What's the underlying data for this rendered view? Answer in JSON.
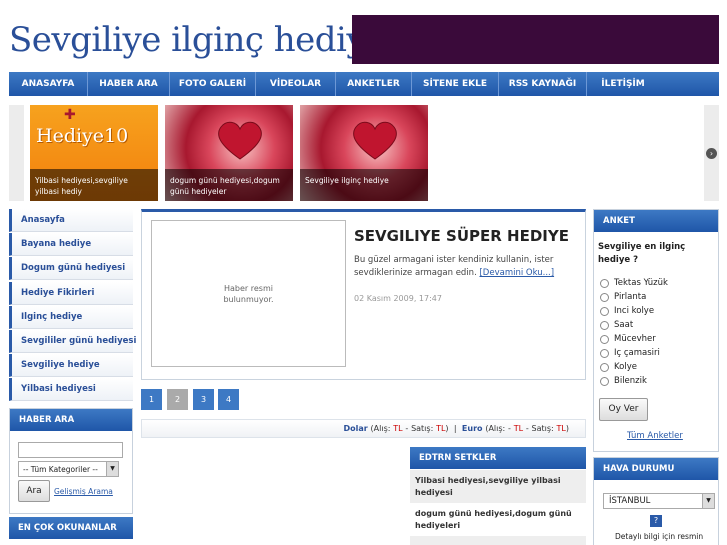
{
  "header": {
    "site_title": "Sevgiliye ilginç hediye",
    "banner_color": "#3a0a3a"
  },
  "nav": {
    "items": [
      "ANASAYFA",
      "HABER ARA",
      "FOTO GALERİ",
      "VİDEOLAR",
      "ANKETLER",
      "SİTENE EKLE",
      "RSS KAYNAĞI",
      "İLETİŞİM"
    ]
  },
  "slider": {
    "logo_text": "Hediye10",
    "slides": [
      {
        "caption": "Yilbasi hediyesi,sevgiliye yilbasi hediy"
      },
      {
        "caption": "dogum günü hediyesi,dogum günü hediyeler"
      },
      {
        "caption": "Sevgiliye ilginç hediye"
      }
    ]
  },
  "sidebar": {
    "items": [
      "Anasayfa",
      "Bayana hediye",
      "Dogum günü hediyesi",
      "Hediye Fikirleri",
      "Ilginç hediye",
      "Sevgililer günü hediyesi",
      "Sevgiliye hediye",
      "Yilbasi hediyesi"
    ]
  },
  "search": {
    "header": "HABER ARA",
    "category": "-- Tüm Kategoriler --",
    "button": "Ara",
    "advanced": "Gelişmiş Arama"
  },
  "most_read": {
    "header": "EN ÇOK OKUNANLAR"
  },
  "article": {
    "no_image_line1": "Haber resmi",
    "no_image_line2": "bulunmuyor.",
    "title": "SEVGILIYE SÜPER HEDIYE",
    "body": "Bu güzel armagani ister kendiniz kullanin, ister sevdiklerinize armagan edin.",
    "more": "[Devamini Oku...]",
    "date": "02 Kasım 2009, 17:47"
  },
  "pagination": [
    "1",
    "2",
    "3",
    "4"
  ],
  "currency": {
    "dolar": "Dolar",
    "euro": "Euro",
    "alis": "Alış:",
    "satis": "Satış:",
    "tl": "TL",
    "dash": "-"
  },
  "editor_picks": {
    "header": "EDTRN SETKLER",
    "items": [
      "Yilbasi hediyesi,sevgiliye yilbasi hediyesi",
      "dogum günü hediyesi,dogum günü hediyeleri"
    ]
  },
  "poll": {
    "header": "ANKET",
    "question": "Sevgiliye en ilginç hediye ?",
    "options": [
      "Tektas Yüzük",
      "Pirlanta",
      "Inci kolye",
      "Saat",
      "Mücevher",
      "Iç çamasiri",
      "Kolye",
      "Bilenzik"
    ],
    "vote_button": "Oy Ver",
    "all_polls": "Tüm Anketler"
  },
  "weather": {
    "header": "HAVA DURUMU",
    "city": "İSTANBUL",
    "note": "Detaylı bilgi için resmin"
  }
}
